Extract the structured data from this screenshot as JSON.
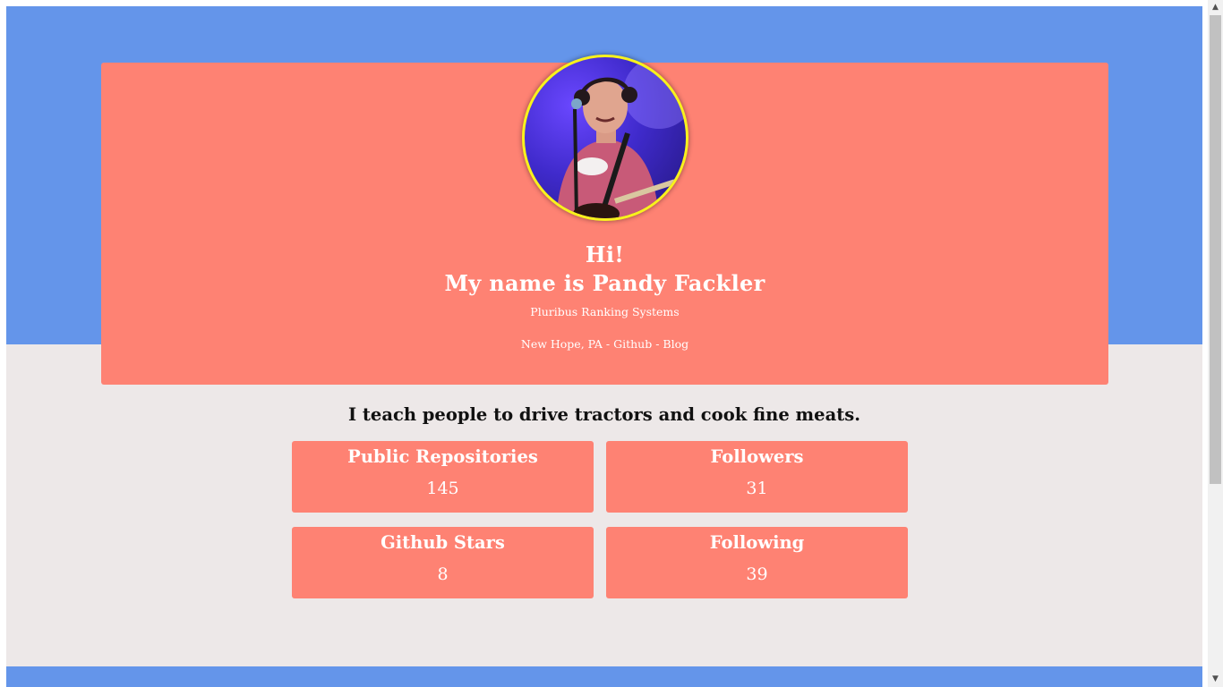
{
  "profile": {
    "greeting": "Hi!",
    "name_line": "My name is Pandy Fackler",
    "company": "Pluribus Ranking Systems",
    "location": "New Hope, PA",
    "separator": " - ",
    "github_link": "Github",
    "blog_link": "Blog"
  },
  "bio": "I teach people to drive tractors and cook fine meats.",
  "stats": [
    {
      "label": "Public Repositories",
      "value": "145"
    },
    {
      "label": "Followers",
      "value": "31"
    },
    {
      "label": "Github Stars",
      "value": "8"
    },
    {
      "label": "Following",
      "value": "39"
    }
  ],
  "colors": {
    "hero_band": "#6495ea",
    "card": "#fe8273",
    "page_background": "#ede8e8",
    "avatar_ring": "#f8f21c"
  },
  "scrollbar": {
    "up_icon": "▲",
    "down_icon": "▼"
  }
}
